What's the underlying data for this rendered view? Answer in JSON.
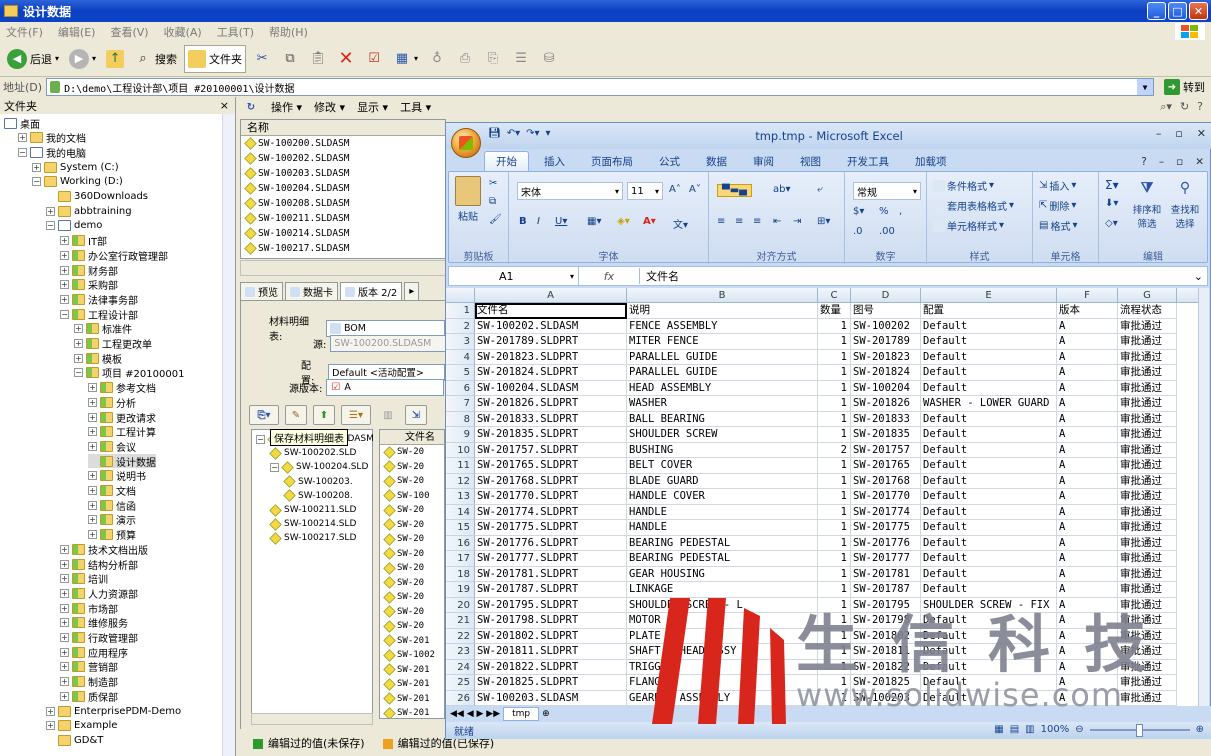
{
  "window": {
    "title": "设计数据",
    "min": "_",
    "max": "□",
    "close": "✕"
  },
  "menu": [
    "文件(F)",
    "编辑(E)",
    "查看(V)",
    "收藏(A)",
    "工具(T)",
    "帮助(H)"
  ],
  "toolbar": {
    "back": "后退",
    "search": "搜索",
    "folders": "文件夹"
  },
  "address": {
    "label": "地址(D)",
    "value": "D:\\demo\\工程设计部\\项目 #20100001\\设计数据",
    "go": "转到"
  },
  "folders_pane": {
    "title": "文件夹",
    "close": "×",
    "items": [
      {
        "label": "桌面",
        "level": 0,
        "pm": "",
        "icon": "desktop-icon"
      },
      {
        "label": "我的文档",
        "level": 1,
        "pm": "+",
        "icon": "folder-icon"
      },
      {
        "label": "我的电脑",
        "level": 1,
        "pm": "−",
        "icon": "computer-icon"
      },
      {
        "label": "System (C:)",
        "level": 2,
        "pm": "+",
        "icon": "drive-icon"
      },
      {
        "label": "Working (D:)",
        "level": 2,
        "pm": "−",
        "icon": "drive-icon"
      },
      {
        "label": "360Downloads",
        "level": 3,
        "pm": "",
        "icon": "folder-icon"
      },
      {
        "label": "abbtraining",
        "level": 3,
        "pm": "+",
        "icon": "folder-icon"
      },
      {
        "label": "demo",
        "level": 3,
        "pm": "−",
        "icon": "vault-icon"
      },
      {
        "label": "IT部",
        "level": 4,
        "pm": "+",
        "icon": "pdm-folder-icon"
      },
      {
        "label": "办公室行政管理部",
        "level": 4,
        "pm": "+",
        "icon": "pdm-folder-icon"
      },
      {
        "label": "财务部",
        "level": 4,
        "pm": "+",
        "icon": "pdm-folder-icon"
      },
      {
        "label": "采购部",
        "level": 4,
        "pm": "+",
        "icon": "pdm-folder-icon"
      },
      {
        "label": "法律事务部",
        "level": 4,
        "pm": "+",
        "icon": "pdm-folder-icon"
      },
      {
        "label": "工程设计部",
        "level": 4,
        "pm": "−",
        "icon": "pdm-folder-icon"
      },
      {
        "label": "标准件",
        "level": 5,
        "pm": "+",
        "icon": "pdm-folder-icon"
      },
      {
        "label": "工程更改单",
        "level": 5,
        "pm": "+",
        "icon": "pdm-folder-icon"
      },
      {
        "label": "模板",
        "level": 5,
        "pm": "+",
        "icon": "pdm-folder-icon"
      },
      {
        "label": "项目 #20100001",
        "level": 5,
        "pm": "−",
        "icon": "pdm-folder-icon"
      },
      {
        "label": "参考文档",
        "level": 6,
        "pm": "+",
        "icon": "pdm-folder-icon"
      },
      {
        "label": "分析",
        "level": 6,
        "pm": "+",
        "icon": "pdm-folder-icon"
      },
      {
        "label": "更改请求",
        "level": 6,
        "pm": "+",
        "icon": "pdm-folder-icon"
      },
      {
        "label": "工程计算",
        "level": 6,
        "pm": "+",
        "icon": "pdm-folder-icon"
      },
      {
        "label": "会议",
        "level": 6,
        "pm": "+",
        "icon": "pdm-folder-icon"
      },
      {
        "label": "设计数据",
        "level": 6,
        "pm": "",
        "icon": "pdm-folder-icon",
        "selected": true
      },
      {
        "label": "说明书",
        "level": 6,
        "pm": "+",
        "icon": "pdm-folder-icon"
      },
      {
        "label": "文档",
        "level": 6,
        "pm": "+",
        "icon": "pdm-folder-icon"
      },
      {
        "label": "信函",
        "level": 6,
        "pm": "+",
        "icon": "pdm-folder-icon"
      },
      {
        "label": "演示",
        "level": 6,
        "pm": "+",
        "icon": "pdm-folder-icon"
      },
      {
        "label": "预算",
        "level": 6,
        "pm": "+",
        "icon": "pdm-folder-icon"
      },
      {
        "label": "技术文档出版",
        "level": 4,
        "pm": "+",
        "icon": "pdm-folder-icon"
      },
      {
        "label": "结构分析部",
        "level": 4,
        "pm": "+",
        "icon": "pdm-folder-icon"
      },
      {
        "label": "培训",
        "level": 4,
        "pm": "+",
        "icon": "pdm-folder-icon"
      },
      {
        "label": "人力资源部",
        "level": 4,
        "pm": "+",
        "icon": "pdm-folder-icon"
      },
      {
        "label": "市场部",
        "level": 4,
        "pm": "+",
        "icon": "pdm-folder-icon"
      },
      {
        "label": "维修服务",
        "level": 4,
        "pm": "+",
        "icon": "pdm-folder-icon"
      },
      {
        "label": "行政管理部",
        "level": 4,
        "pm": "+",
        "icon": "pdm-folder-icon"
      },
      {
        "label": "应用程序",
        "level": 4,
        "pm": "+",
        "icon": "pdm-folder-icon"
      },
      {
        "label": "营销部",
        "level": 4,
        "pm": "+",
        "icon": "pdm-folder-icon"
      },
      {
        "label": "制造部",
        "level": 4,
        "pm": "+",
        "icon": "pdm-folder-icon"
      },
      {
        "label": "质保部",
        "level": 4,
        "pm": "+",
        "icon": "pdm-folder-icon"
      },
      {
        "label": "EnterprisePDM-Demo",
        "level": 3,
        "pm": "+",
        "icon": "folder-icon"
      },
      {
        "label": "Example",
        "level": 3,
        "pm": "+",
        "icon": "folder-icon"
      },
      {
        "label": "GD&T",
        "level": 3,
        "pm": "",
        "icon": "folder-icon"
      }
    ]
  },
  "pdm_toolbar": [
    "操作",
    "修改",
    "显示",
    "工具"
  ],
  "file_list": {
    "header": "名称",
    "files": [
      "SW-100200.SLDASM",
      "SW-100202.SLDASM",
      "SW-100203.SLDASM",
      "SW-100204.SLDASM",
      "SW-100208.SLDASM",
      "SW-100211.SLDASM",
      "SW-100214.SLDASM",
      "SW-100217.SLDASM"
    ]
  },
  "tabs": [
    "预览",
    "数据卡",
    "版本 2/2"
  ],
  "bom": {
    "material_label": "材料明细表:",
    "material_value": "BOM",
    "source_label": "源:",
    "source_value": "SW-100200.SLDASM",
    "config_label": "配置:",
    "config_value": "Default <活动配置>",
    "revision_label": "源版本:",
    "revision_value": "A",
    "tooltip": "保存材料明细表",
    "col_header": "文件名",
    "tree": [
      "SW-100200.SLDASM",
      "SW-100202.SLD",
      "SW-100204.SLD",
      "SW-100203.",
      "SW-100208.",
      "SW-100211.SLD",
      "SW-100214.SLD",
      "SW-100217.SLD"
    ],
    "right_list": [
      "SW-20",
      "SW-20",
      "SW-20",
      "SW-100",
      "SW-20",
      "SW-20",
      "SW-20",
      "SW-20",
      "SW-20",
      "SW-20",
      "SW-20",
      "SW-20",
      "SW-20",
      "SW-201",
      "SW-1002",
      "SW-201",
      "SW-201",
      "SW-201",
      "SW-201",
      "SW-201"
    ]
  },
  "status": {
    "unsaved": "编辑过的值(未保存)",
    "saved": "编辑过的值(已保存)",
    "colors": {
      "unsaved": "#2e9b2e",
      "saved": "#f0a21e"
    }
  },
  "excel": {
    "title": "tmp.tmp - Microsoft Excel",
    "ribbon_tabs": [
      "开始",
      "插入",
      "页面布局",
      "公式",
      "数据",
      "审阅",
      "视图",
      "开发工具",
      "加载项"
    ],
    "groups": [
      "剪贴板",
      "字体",
      "对齐方式",
      "数字",
      "样式",
      "单元格",
      "编辑"
    ],
    "paste": "粘贴",
    "font_name": "宋体",
    "font_size": "11",
    "number_format": "常规",
    "styles": [
      "条件格式",
      "套用表格格式",
      "单元格样式"
    ],
    "cells_grp": [
      "插入",
      "删除",
      "格式"
    ],
    "edit_grp": [
      "排序和筛选",
      "查找和选择"
    ],
    "name_box": "A1",
    "fx": "fx",
    "formula": "文件名",
    "columns": [
      "A",
      "B",
      "C",
      "D",
      "E",
      "F",
      "G"
    ],
    "rows": [
      [
        "文件名",
        "说明",
        "数量",
        "图号",
        "配置",
        "版本",
        "流程状态"
      ],
      [
        "SW-100202.SLDASM",
        "FENCE ASSEMBLY",
        "1",
        "SW-100202",
        "Default",
        "A",
        "审批通过"
      ],
      [
        "   SW-201789.SLDPRT",
        "MITER FENCE",
        "1",
        "SW-201789",
        "Default",
        "A",
        "审批通过"
      ],
      [
        "   SW-201823.SLDPRT",
        "PARALLEL GUIDE",
        "1",
        "SW-201823",
        "Default",
        "A",
        "审批通过"
      ],
      [
        "   SW-201824.SLDPRT",
        "PARALLEL GUIDE",
        "1",
        "SW-201824",
        "Default",
        "A",
        "审批通过"
      ],
      [
        "SW-100204.SLDASM",
        "HEAD ASSEMBLY",
        "1",
        "SW-100204",
        "Default",
        "A",
        "审批通过"
      ],
      [
        "   SW-201826.SLDPRT",
        "WASHER",
        "1",
        "SW-201826",
        "WASHER - LOWER GUARD",
        "A",
        "审批通过"
      ],
      [
        "   SW-201833.SLDPRT",
        "BALL BEARING",
        "1",
        "SW-201833",
        "Default",
        "A",
        "审批通过"
      ],
      [
        "   SW-201835.SLDPRT",
        "SHOULDER SCREW",
        "1",
        "SW-201835",
        "Default",
        "A",
        "审批通过"
      ],
      [
        "   SW-201757.SLDPRT",
        "BUSHING",
        "2",
        "SW-201757",
        "Default",
        "A",
        "审批通过"
      ],
      [
        "   SW-201765.SLDPRT",
        "BELT COVER",
        "1",
        "SW-201765",
        "Default",
        "A",
        "审批通过"
      ],
      [
        "   SW-201768.SLDPRT",
        "BLADE GUARD",
        "1",
        "SW-201768",
        "Default",
        "A",
        "审批通过"
      ],
      [
        "   SW-201770.SLDPRT",
        "HANDLE COVER",
        "1",
        "SW-201770",
        "Default",
        "A",
        "审批通过"
      ],
      [
        "   SW-201774.SLDPRT",
        "HANDLE",
        "1",
        "SW-201774",
        "Default",
        "A",
        "审批通过"
      ],
      [
        "   SW-201775.SLDPRT",
        "HANDLE",
        "1",
        "SW-201775",
        "Default",
        "A",
        "审批通过"
      ],
      [
        "   SW-201776.SLDPRT",
        "BEARING PEDESTAL",
        "1",
        "SW-201776",
        "Default",
        "A",
        "审批通过"
      ],
      [
        "   SW-201777.SLDPRT",
        "BEARING PEDESTAL",
        "1",
        "SW-201777",
        "Default",
        "A",
        "审批通过"
      ],
      [
        "   SW-201781.SLDPRT",
        "GEAR HOUSING",
        "1",
        "SW-201781",
        "Default",
        "A",
        "审批通过"
      ],
      [
        "   SW-201787.SLDPRT",
        "LINKAGE",
        "1",
        "SW-201787",
        "Default",
        "A",
        "审批通过"
      ],
      [
        "   SW-201795.SLDPRT",
        "SHOULDER SCREW - L",
        "1",
        "SW-201795",
        "SHOULDER SCREW - FIX",
        "A",
        "审批通过"
      ],
      [
        "   SW-201798.SLDPRT",
        "MOTOR",
        "1",
        "SW-201798",
        "Default",
        "A",
        "审批通过"
      ],
      [
        "   SW-201802.SLDPRT",
        "PLATE",
        "1",
        "SW-201802",
        "Default",
        "A",
        "审批通过"
      ],
      [
        "   SW-201811.SLDPRT",
        "SHAFT - HEAD ASSY",
        "1",
        "SW-201811",
        "Default",
        "A",
        "审批通过"
      ],
      [
        "   SW-201822.SLDPRT",
        "TRIGGER",
        "1",
        "SW-201822",
        "Default",
        "A",
        "审批通过"
      ],
      [
        "   SW-201825.SLDPRT",
        "FLANGE",
        "1",
        "SW-201825",
        "Default",
        "A",
        "审批通过"
      ],
      [
        "SW-100203.SLDASM",
        "GEARBOX ASSEMBLY",
        "1",
        "SW-100203",
        "Default",
        "A",
        "审批通过"
      ]
    ],
    "sheet_tab": "tmp",
    "status_ready": "就绪",
    "zoom": "100%"
  },
  "watermark": {
    "text": "生信科技",
    "url": "www.solidwise.com",
    "color": "#d9261c"
  }
}
